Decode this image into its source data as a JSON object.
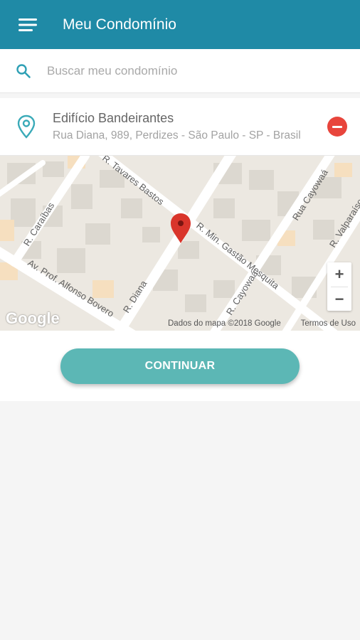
{
  "appbar": {
    "title": "Meu Condomínio"
  },
  "search": {
    "placeholder": "Buscar meu condomínio"
  },
  "address": {
    "name": "Edifício Bandeirantes",
    "line": "Rua Diana, 989, Perdizes - São Paulo - SP - Brasil"
  },
  "map": {
    "streets": {
      "tavares": "R. Tavares Bastos",
      "caraibas": "R. Caraíbas",
      "gastao": "R. Min. Gastão Mesquita",
      "cayowaa1": "Rua Cayowaá",
      "cayowaa2": "R. Cayowaá",
      "valparaiso": "R. Valparaíso",
      "alfonso": "Av. Prof. Alfonso Bovero",
      "diana": "R. Diana"
    },
    "zoom_in": "+",
    "zoom_out": "−",
    "logo": "Google",
    "attribution": "Dados do mapa ©2018 Google",
    "terms": "Termos de Uso"
  },
  "actions": {
    "continue_label": "CONTINUAR"
  },
  "colors": {
    "appbar": "#1f8aa6",
    "accent": "#3aaab8",
    "button": "#5cb7b5",
    "remove": "#e8453c",
    "marker": "#d9352b"
  }
}
